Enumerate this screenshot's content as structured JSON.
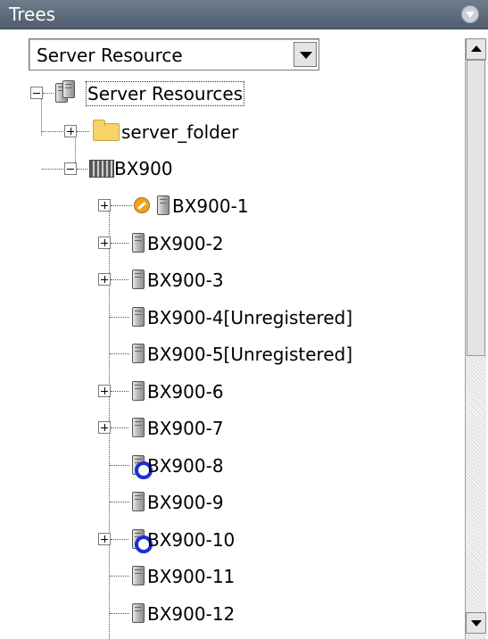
{
  "panel": {
    "title": "Trees",
    "menu_icon": "chevron-down-icon"
  },
  "selector": {
    "value": "Server Resource"
  },
  "tree": {
    "root": {
      "label": "Server Resources",
      "expanded": true,
      "icon": "server-icon"
    },
    "folder": {
      "label": "server_folder",
      "expanded": false,
      "icon": "folder-icon"
    },
    "chassis": {
      "label": "BX900",
      "expanded": true,
      "icon": "chassis-icon"
    },
    "servers": [
      {
        "label": "BX900-1",
        "has_children": true,
        "status_icon": "warning-icon"
      },
      {
        "label": "BX900-2",
        "has_children": true,
        "status_icon": ""
      },
      {
        "label": "BX900-3",
        "has_children": true,
        "status_icon": ""
      },
      {
        "label": "BX900-4[Unregistered]",
        "has_children": false,
        "status_icon": ""
      },
      {
        "label": "BX900-5[Unregistered]",
        "has_children": false,
        "status_icon": ""
      },
      {
        "label": "BX900-6",
        "has_children": true,
        "status_icon": ""
      },
      {
        "label": "BX900-7",
        "has_children": true,
        "status_icon": ""
      },
      {
        "label": "BX900-8",
        "has_children": false,
        "status_icon": "status-ring-icon"
      },
      {
        "label": "BX900-9",
        "has_children": false,
        "status_icon": ""
      },
      {
        "label": "BX900-10",
        "has_children": true,
        "status_icon": "status-ring-icon"
      },
      {
        "label": "BX900-11",
        "has_children": false,
        "status_icon": ""
      },
      {
        "label": "BX900-12",
        "has_children": false,
        "status_icon": ""
      }
    ]
  },
  "colors": {
    "title_bar": "#5f6d7d",
    "status_ring": "#1a2fd6",
    "warning": "#f0a020",
    "folder": "#f7d46a"
  }
}
